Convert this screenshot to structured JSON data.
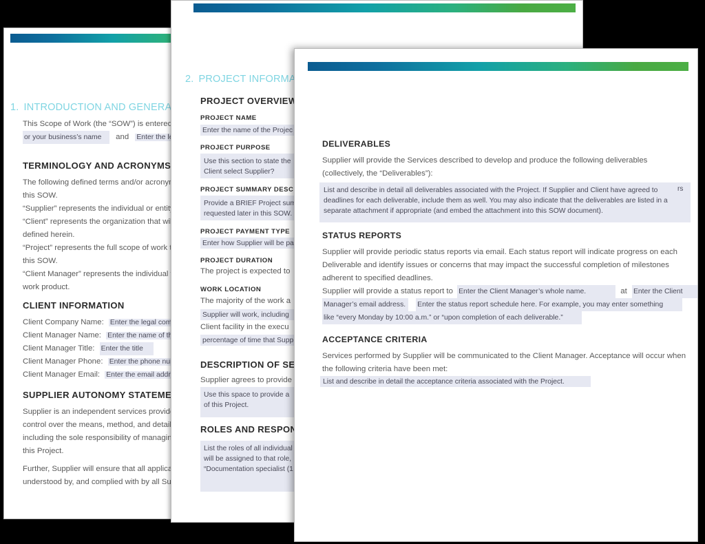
{
  "meta": {
    "doc_kind": "Scope of Work (SOW) template preview",
    "accent_heading_color": "#7fd5e2",
    "field_highlight_color": "#e6e8f2",
    "gradient_from": "#0b5c91",
    "gradient_mid": "#12a0a8",
    "gradient_to": "#4caf45"
  },
  "back_page": {
    "section_number": "1.",
    "section_title": "INTRODUCTION AND GENERAL INF",
    "intro_line": "This Scope of Work (the “SOW”) is entered in",
    "intro_field_1": "or your business’s name",
    "intro_joiner": "and",
    "intro_field_2": "Enter the legal",
    "terminology": {
      "heading": "TERMINOLOGY AND ACRONYMS",
      "lines": [
        "The following defined terms and/or acronym",
        "this SOW.",
        "“Supplier” represents the individual or entity",
        "“Client” represents the organization that will",
        "defined herein.",
        "“Project” represents the full scope of work th",
        "this SOW.",
        " “Client Manager” represents the individual w",
        "work product."
      ]
    },
    "client_information": {
      "heading": "CLIENT INFORMATION",
      "rows": [
        {
          "label": "Client Company Name:",
          "value": "Enter the legal compan"
        },
        {
          "label": "Client Manager Name:",
          "value": "Enter the name of the m"
        },
        {
          "label": "Client Manager Title:",
          "value": "Enter the title"
        },
        {
          "label": "Client Manager Phone:",
          "value": "Enter the phone numbe"
        },
        {
          "label": "Client Manager Email:",
          "value": "Enter the email address"
        }
      ]
    },
    "supplier_autonomy": {
      "heading": "SUPPLIER AUTONOMY STATEMENT",
      "lines": [
        "Supplier is an independent services provide",
        "control over the means, method, and details",
        "including the sole responsibility of managing",
        "this Project.",
        "Further, Supplier will ensure that all applicab",
        "understood by, and complied with by all Sup"
      ]
    }
  },
  "mid_page": {
    "section_number": "2.",
    "section_title": "PROJECT INFORMAT",
    "project_overview_heading": "PROJECT OVERVIEW",
    "fields": [
      {
        "label": "PROJECT NAME",
        "kind": "field",
        "text": "Enter the name of the Projec"
      },
      {
        "label": "PROJECT PURPOSE",
        "kind": "block",
        "text": "Use this section to state the \nClient select Supplier?"
      },
      {
        "label": "PROJECT SUMMARY DESCRI",
        "kind": "block",
        "text": "Provide a BRIEF Project sum\nrequested later in this SOW."
      },
      {
        "label": "PROJECT PAYMENT TYPE",
        "kind": "field",
        "text": "Enter how Supplier will be pa"
      },
      {
        "label": "PROJECT DURATION",
        "kind": "body",
        "text": "The project is expected to"
      },
      {
        "label": "WORK LOCATION",
        "kind": "mixed",
        "text": ""
      }
    ],
    "work_location_lines": [
      {
        "style": "body",
        "text": "The majority of the work a"
      },
      {
        "style": "field",
        "text": "Supplier will work, including "
      },
      {
        "style": "body",
        "text": "Client facility in the execu"
      },
      {
        "style": "field",
        "text": "percentage of time that Supp"
      }
    ],
    "description_of_services": {
      "heading": "DESCRIPTION OF SERV",
      "body": "Supplier agrees to provide",
      "block": "Use this space to provide a \nof this Project."
    },
    "roles_and_responsibilities": {
      "heading": "ROLES AND RESPONS",
      "block": "List the roles of all individual\nwill be assigned to that role, \n“Documentation specialist (1"
    }
  },
  "front_page": {
    "deliverables": {
      "heading": "DELIVERABLES",
      "body_lines": [
        "Supplier will provide the Services described to develop and produce the following deliverables",
        "(collectively, the “Deliverables”):"
      ],
      "block_lines": [
        "List and describe in detail all deliverables associated with the Project. If Supplier and Client have agreed to",
        "deadlines for each deliverable, include them as well. You may also indicate that the deliverables are listed in a",
        "separate attachment if appropriate (and embed the attachment into this SOW document)."
      ],
      "edge_fragment": "rs"
    },
    "status_reports": {
      "heading": "STATUS REPORTS",
      "body_lines": [
        "Supplier will provide periodic status reports via email. Each status report will indicate progress on each",
        "Deliverable and identify issues or concerns that may impact the successful completion of milestones",
        "adherent to specified deadlines."
      ],
      "run_prefix": "Supplier will provide a status report to",
      "field_name": "Enter the Client Manager’s whole name.",
      "run_joiner": "at",
      "field_email_part1": "Enter the Client",
      "field_email_part2": "Manager’s email address.",
      "field_schedule_line1": "Enter the status report schedule here. For example, you may enter something",
      "field_schedule_line2": "like “every Monday by 10:00 a.m.” or “upon completion of each deliverable.”"
    },
    "acceptance_criteria": {
      "heading": "ACCEPTANCE CRITERIA",
      "body_lines": [
        "Services performed by Supplier will be communicated to the Client Manager. Acceptance will occur when",
        "the following criteria have been met:"
      ],
      "block": "List and describe in detail the acceptance criteria associated with the Project."
    }
  }
}
